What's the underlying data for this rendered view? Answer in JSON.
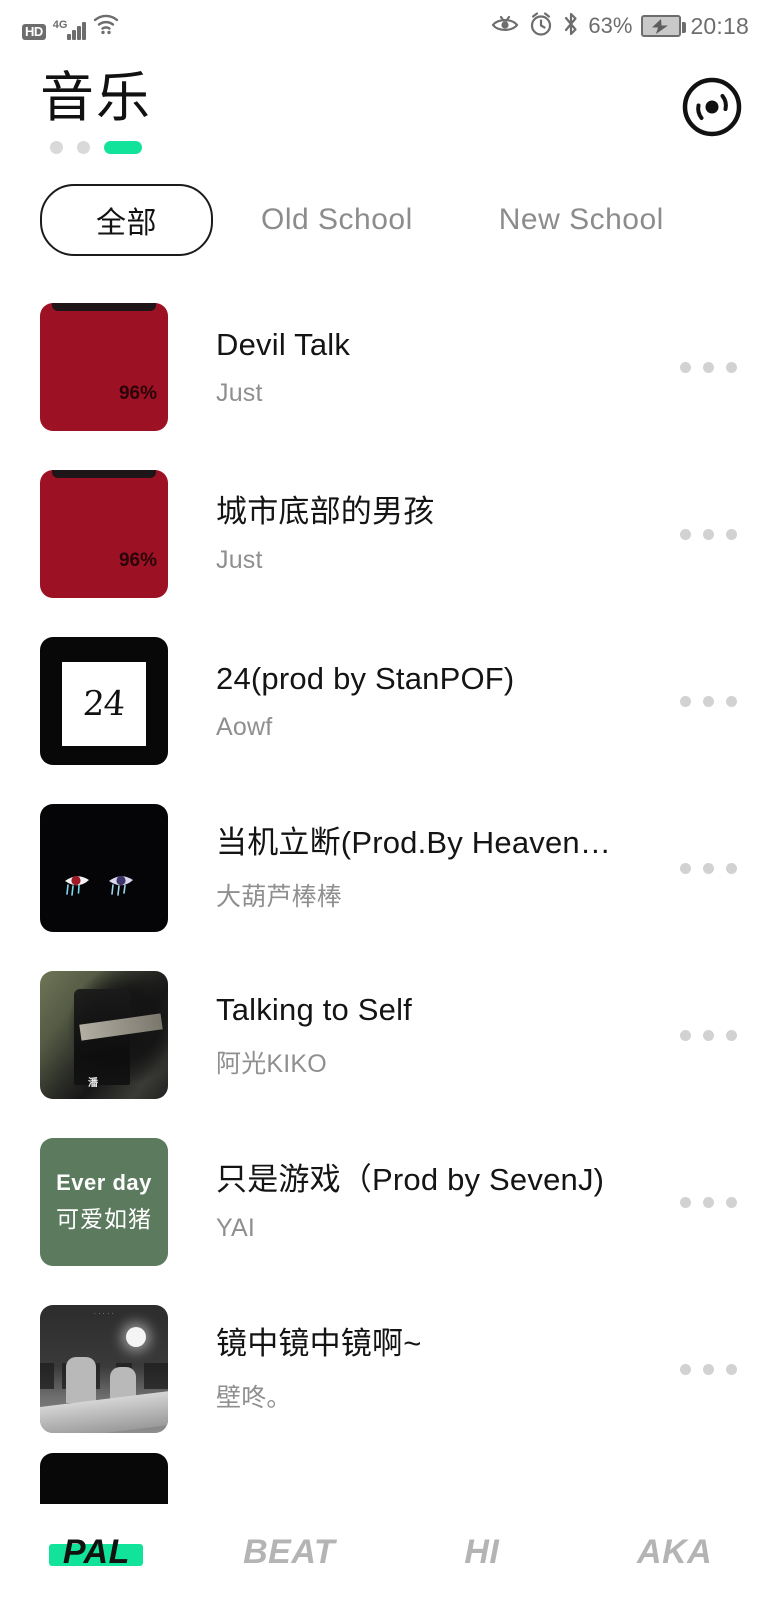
{
  "statusbar": {
    "hd_label": "HD",
    "network_label": "4G",
    "wifi_icon": "wifi-icon",
    "signal_icon": "signal-bars-icon",
    "eyecare_icon": "eye-care-icon",
    "alarm_icon": "alarm-clock-icon",
    "bluetooth_icon": "bluetooth-icon",
    "battery_percent": "63%",
    "battery_icon": "battery-charging-icon",
    "time": "20:18"
  },
  "header": {
    "title": "音乐",
    "disc_icon": "vinyl-record-icon",
    "page_dots": [
      {
        "active": false
      },
      {
        "active": false
      },
      {
        "active": true
      }
    ]
  },
  "tabs": [
    {
      "label": "全部",
      "selected": true
    },
    {
      "label": "Old School",
      "selected": false
    },
    {
      "label": "New School",
      "selected": false
    }
  ],
  "tracks": [
    {
      "title": "Devil Talk",
      "artist": "Just",
      "art": {
        "kind": "battery",
        "badge": "96%",
        "color": "#9c1124"
      },
      "more_icon": "more-options-icon"
    },
    {
      "title": "城市底部的男孩",
      "artist": "Just",
      "art": {
        "kind": "battery",
        "badge": "96%",
        "color": "#9c1124"
      },
      "more_icon": "more-options-icon"
    },
    {
      "title": "24(prod by StanPOF)",
      "artist": "Aowf",
      "art": {
        "kind": "square-24",
        "badge": "24",
        "color": "#080808"
      },
      "more_icon": "more-options-icon"
    },
    {
      "title": "当机立断(Prod.By Heaven…",
      "artist": "大葫芦棒棒",
      "art": {
        "kind": "eyes",
        "badge": "",
        "color": "#050508"
      },
      "more_icon": "more-options-icon"
    },
    {
      "title": "Talking to Self",
      "artist": "阿光KIKO",
      "art": {
        "kind": "photo",
        "badge": "潘",
        "color": "#3a3a36"
      },
      "more_icon": "more-options-icon"
    },
    {
      "title": "只是游戏（Prod by SevenJ)",
      "artist": "YAI",
      "art": {
        "kind": "green-text",
        "badge": "Ever day",
        "badge2": "可爱如猪",
        "color": "#5c7a5e"
      },
      "more_icon": "more-options-icon"
    },
    {
      "title": "镜中镜中镜啊~",
      "artist": "壁咚。",
      "art": {
        "kind": "night",
        "badge": "",
        "color": "#3a3a3a"
      },
      "more_icon": "more-options-icon"
    }
  ],
  "partial_track": {
    "art": {
      "kind": "black",
      "color": "#080808"
    }
  },
  "bottomnav": [
    {
      "label": "PAL",
      "active": true
    },
    {
      "label": "BEAT",
      "active": false
    },
    {
      "label": "HI",
      "active": false
    },
    {
      "label": "AKA",
      "active": false
    }
  ],
  "colors": {
    "accent_green": "#11e49a",
    "text_primary": "#141414",
    "text_secondary": "#8f8f8f",
    "status_gray": "#6d6d6d"
  }
}
